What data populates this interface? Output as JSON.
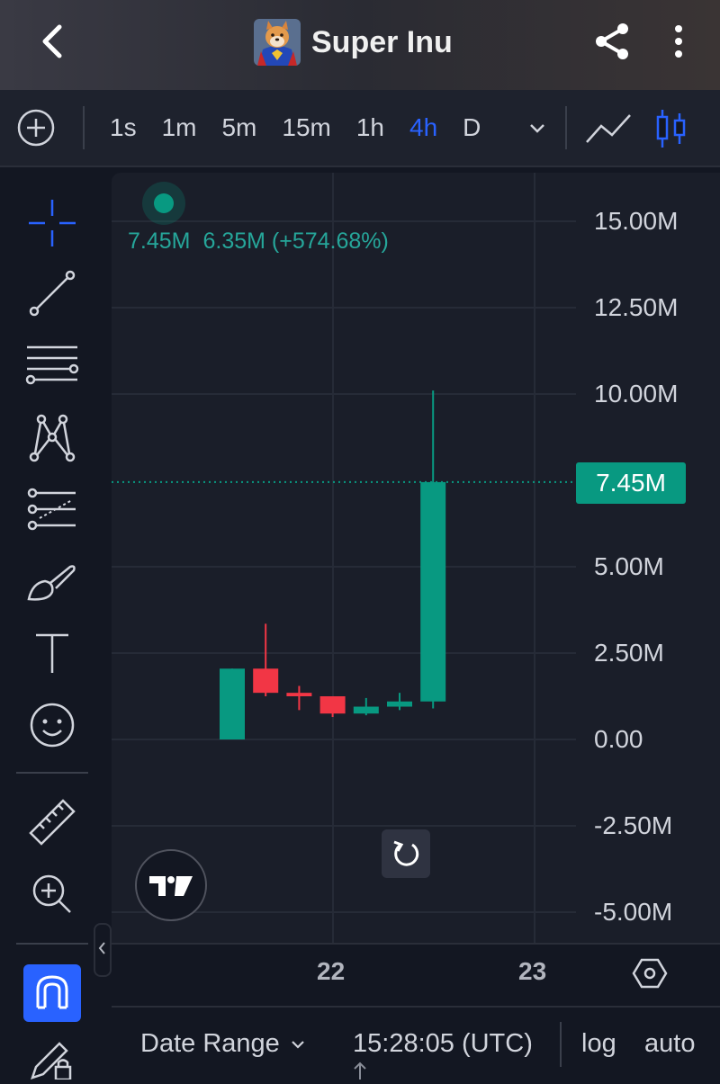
{
  "header": {
    "title": "Super Inu",
    "back_icon": "chevron-left-icon",
    "share_icon": "share-icon",
    "more_icon": "more-vertical-icon"
  },
  "toolbar": {
    "intervals": [
      "1s",
      "1m",
      "5m",
      "15m",
      "1h",
      "4h",
      "D"
    ],
    "active_interval": "4h"
  },
  "legend": {
    "price": "7.45M",
    "change": "6.35M (+574.68%)"
  },
  "price_axis": [
    "15.00M",
    "12.50M",
    "10.00M",
    "5.00M",
    "2.50M",
    "0.00",
    "-2.50M",
    "-5.00M"
  ],
  "current_price": "7.45M",
  "time_axis": [
    "22",
    "23"
  ],
  "bottom_bar": {
    "date_range": "Date Range",
    "clock": "15:28:05 (UTC)",
    "log": "log",
    "auto": "auto"
  },
  "colors": {
    "up": "#089981",
    "down": "#f23645",
    "accent": "#2962ff",
    "background": "#131722"
  },
  "chart_data": {
    "type": "candlestick",
    "xlabel": "",
    "ylabel": "",
    "y_ticks": [
      -5000000,
      -2500000,
      0,
      2500000,
      5000000,
      7450000,
      10000000,
      12500000,
      15000000
    ],
    "ylim": [
      -5500000,
      16000000
    ],
    "candles": [
      {
        "open": 0.0,
        "high": 2.05,
        "low": 0.0,
        "close": 2.05
      },
      {
        "open": 2.05,
        "high": 3.35,
        "low": 1.25,
        "close": 1.35
      },
      {
        "open": 1.35,
        "high": 1.55,
        "low": 0.85,
        "close": 1.25
      },
      {
        "open": 1.25,
        "high": 1.25,
        "low": 0.65,
        "close": 0.75
      },
      {
        "open": 0.75,
        "high": 1.2,
        "low": 0.7,
        "close": 0.95
      },
      {
        "open": 0.95,
        "high": 1.35,
        "low": 0.85,
        "close": 1.1
      },
      {
        "open": 1.1,
        "high": 10.1,
        "low": 0.9,
        "close": 7.45
      }
    ],
    "value_unit": "M",
    "current_price_line": 7.45
  }
}
